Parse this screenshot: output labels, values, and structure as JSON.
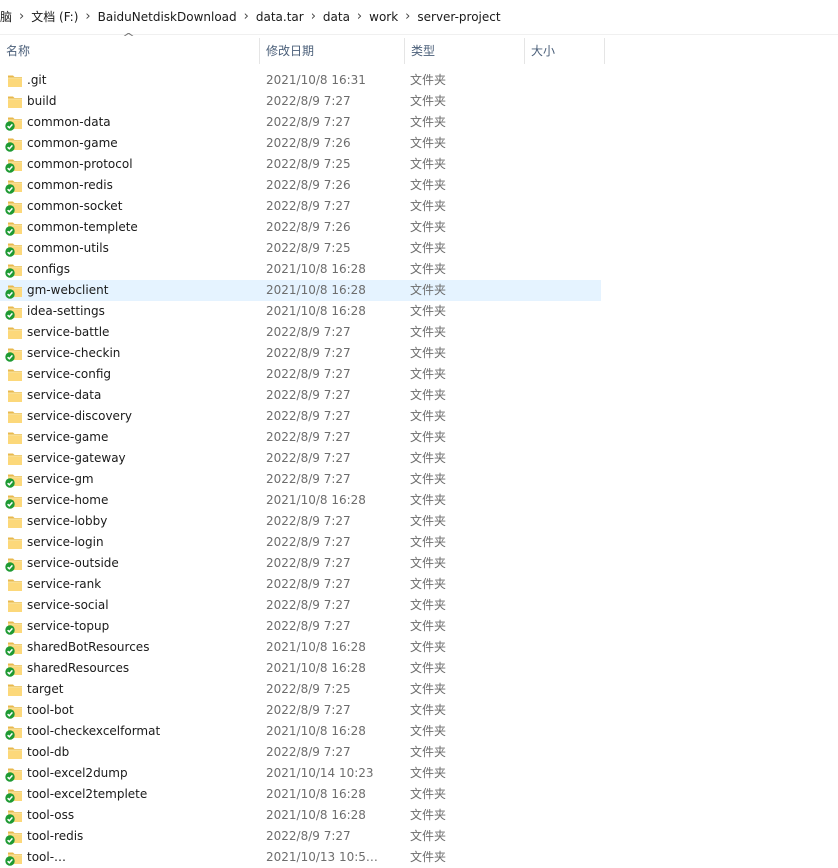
{
  "breadcrumb": [
    "脑",
    "文档 (F:)",
    "BaiduNetdiskDownload",
    "data.tar",
    "data",
    "work",
    "server-project"
  ],
  "columns": {
    "name": "名称",
    "date": "修改日期",
    "type": "类型",
    "size": "大小"
  },
  "selected_index": 10,
  "rows": [
    {
      "name": ".git",
      "date": "2021/10/8 16:31",
      "type": "文件夹",
      "synced": false
    },
    {
      "name": "build",
      "date": "2022/8/9 7:27",
      "type": "文件夹",
      "synced": false
    },
    {
      "name": "common-data",
      "date": "2022/8/9 7:27",
      "type": "文件夹",
      "synced": true
    },
    {
      "name": "common-game",
      "date": "2022/8/9 7:26",
      "type": "文件夹",
      "synced": true
    },
    {
      "name": "common-protocol",
      "date": "2022/8/9 7:25",
      "type": "文件夹",
      "synced": true
    },
    {
      "name": "common-redis",
      "date": "2022/8/9 7:26",
      "type": "文件夹",
      "synced": true
    },
    {
      "name": "common-socket",
      "date": "2022/8/9 7:27",
      "type": "文件夹",
      "synced": true
    },
    {
      "name": "common-templete",
      "date": "2022/8/9 7:26",
      "type": "文件夹",
      "synced": true
    },
    {
      "name": "common-utils",
      "date": "2022/8/9 7:25",
      "type": "文件夹",
      "synced": true
    },
    {
      "name": "configs",
      "date": "2021/10/8 16:28",
      "type": "文件夹",
      "synced": true
    },
    {
      "name": "gm-webclient",
      "date": "2021/10/8 16:28",
      "type": "文件夹",
      "synced": true
    },
    {
      "name": "idea-settings",
      "date": "2021/10/8 16:28",
      "type": "文件夹",
      "synced": true
    },
    {
      "name": "service-battle",
      "date": "2022/8/9 7:27",
      "type": "文件夹",
      "synced": false
    },
    {
      "name": "service-checkin",
      "date": "2022/8/9 7:27",
      "type": "文件夹",
      "synced": true
    },
    {
      "name": "service-config",
      "date": "2022/8/9 7:27",
      "type": "文件夹",
      "synced": false
    },
    {
      "name": "service-data",
      "date": "2022/8/9 7:27",
      "type": "文件夹",
      "synced": false
    },
    {
      "name": "service-discovery",
      "date": "2022/8/9 7:27",
      "type": "文件夹",
      "synced": false
    },
    {
      "name": "service-game",
      "date": "2022/8/9 7:27",
      "type": "文件夹",
      "synced": false
    },
    {
      "name": "service-gateway",
      "date": "2022/8/9 7:27",
      "type": "文件夹",
      "synced": false
    },
    {
      "name": "service-gm",
      "date": "2022/8/9 7:27",
      "type": "文件夹",
      "synced": true
    },
    {
      "name": "service-home",
      "date": "2021/10/8 16:28",
      "type": "文件夹",
      "synced": true
    },
    {
      "name": "service-lobby",
      "date": "2022/8/9 7:27",
      "type": "文件夹",
      "synced": false
    },
    {
      "name": "service-login",
      "date": "2022/8/9 7:27",
      "type": "文件夹",
      "synced": false
    },
    {
      "name": "service-outside",
      "date": "2022/8/9 7:27",
      "type": "文件夹",
      "synced": true
    },
    {
      "name": "service-rank",
      "date": "2022/8/9 7:27",
      "type": "文件夹",
      "synced": false
    },
    {
      "name": "service-social",
      "date": "2022/8/9 7:27",
      "type": "文件夹",
      "synced": false
    },
    {
      "name": "service-topup",
      "date": "2022/8/9 7:27",
      "type": "文件夹",
      "synced": true
    },
    {
      "name": "sharedBotResources",
      "date": "2021/10/8 16:28",
      "type": "文件夹",
      "synced": true
    },
    {
      "name": "sharedResources",
      "date": "2021/10/8 16:28",
      "type": "文件夹",
      "synced": true
    },
    {
      "name": "target",
      "date": "2022/8/9 7:25",
      "type": "文件夹",
      "synced": false
    },
    {
      "name": "tool-bot",
      "date": "2022/8/9 7:27",
      "type": "文件夹",
      "synced": true
    },
    {
      "name": "tool-checkexcelformat",
      "date": "2021/10/8 16:28",
      "type": "文件夹",
      "synced": true
    },
    {
      "name": "tool-db",
      "date": "2022/8/9 7:27",
      "type": "文件夹",
      "synced": false
    },
    {
      "name": "tool-excel2dump",
      "date": "2021/10/14 10:23",
      "type": "文件夹",
      "synced": true
    },
    {
      "name": "tool-excel2templete",
      "date": "2021/10/8 16:28",
      "type": "文件夹",
      "synced": true
    },
    {
      "name": "tool-oss",
      "date": "2021/10/8 16:28",
      "type": "文件夹",
      "synced": true
    },
    {
      "name": "tool-redis",
      "date": "2022/8/9 7:27",
      "type": "文件夹",
      "synced": true
    },
    {
      "name": "tool-…",
      "date": "2021/10/13 10:5…",
      "type": "文件夹",
      "synced": true
    }
  ]
}
